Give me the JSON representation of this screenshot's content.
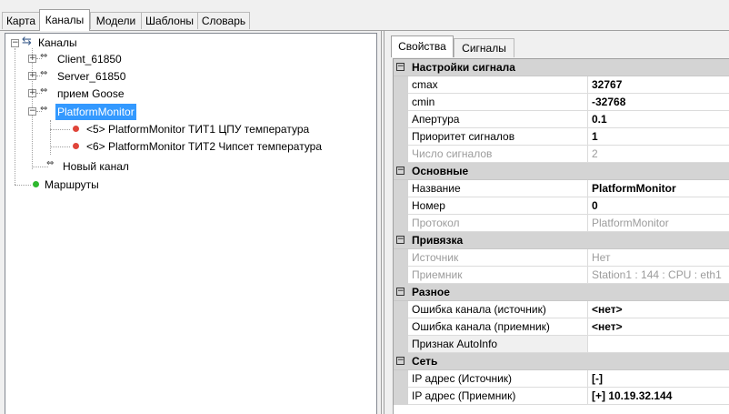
{
  "top_tabs": [
    "Карта",
    "Каналы",
    "Модели",
    "Шаблоны",
    "Словарь"
  ],
  "tree": {
    "root": "Каналы",
    "channels": [
      "Client_61850",
      "Server_61850",
      "прием Goose",
      "PlatformMonitor"
    ],
    "signals": [
      "<5> PlatformMonitor ТИТ1 ЦПУ температура",
      "<6> PlatformMonitor ТИТ2 Чипсет температура"
    ],
    "new_channel": "Новый канал",
    "routes": "Маршруты"
  },
  "right_tabs": [
    "Свойства",
    "Сигналы"
  ],
  "grid": {
    "cat1": {
      "label": "Настройки сигнала"
    },
    "r1": {
      "name": "cmax",
      "value": "32767"
    },
    "r2": {
      "name": "cmin",
      "value": "-32768"
    },
    "r3": {
      "name": "Апертура",
      "value": "0.1"
    },
    "r4": {
      "name": "Приоритет сигналов",
      "value": "1"
    },
    "r5": {
      "name": "Число сигналов",
      "value": "2"
    },
    "cat2": {
      "label": "Основные"
    },
    "r6": {
      "name": "Название",
      "value": "PlatformMonitor"
    },
    "r7": {
      "name": "Номер",
      "value": "0"
    },
    "r8": {
      "name": "Протокол",
      "value": "PlatformMonitor"
    },
    "cat3": {
      "label": "Привязка"
    },
    "r9": {
      "name": "Источник",
      "value": "Нет"
    },
    "r10": {
      "name": "Приемник",
      "value": "Station1 : 144 : CPU : eth1"
    },
    "cat4": {
      "label": "Разное"
    },
    "r11": {
      "name": "Ошибка канала (источник)",
      "value": "<нет>"
    },
    "r12": {
      "name": "Ошибка канала (приемник)",
      "value": "<нет>"
    },
    "r13": {
      "name": "Признак AutoInfo",
      "value": ""
    },
    "cat5": {
      "label": "Сеть"
    },
    "r14": {
      "name": "IP адрес (Источник)",
      "value": "[-]"
    },
    "r15": {
      "name": "IP адрес (Приемник)",
      "value": "[+] 10.19.32.144"
    }
  },
  "colors": {
    "selection": "#3399ff",
    "category_bg": "#d4d4d4",
    "red_dot": "#e0453a",
    "green_dot": "#2eb82e"
  }
}
